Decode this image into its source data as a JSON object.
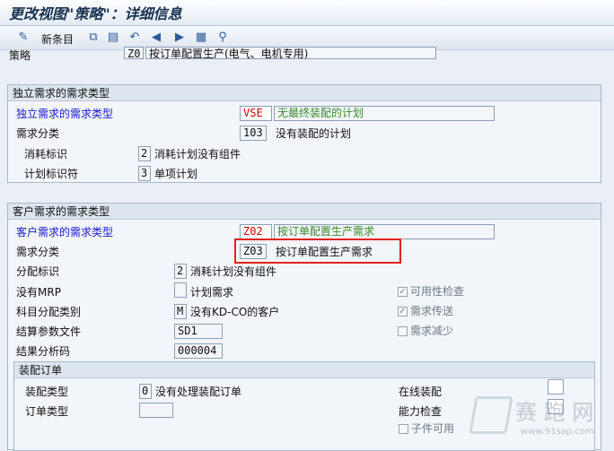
{
  "window": {
    "title": "更改视图\"策略\"：详细信息"
  },
  "toolbar": {
    "new_entries_label": "新条目"
  },
  "strategy": {
    "label": "策略",
    "code": "Z0",
    "description": "按订单配置生产(电气、电机专用)"
  },
  "independent": {
    "group_title": "独立需求的需求类型",
    "req_type_label": "独立需求的需求类型",
    "req_type_code": "VSE",
    "req_type_desc": "无最终装配的计划",
    "req_class_label": "需求分类",
    "req_class_code": "103",
    "req_class_desc": "没有装配的计划",
    "consumption_label": "消耗标识",
    "consumption_code": "2",
    "consumption_desc": "消耗计划没有组件",
    "planning_ind_label": "计划标识符",
    "planning_ind_code": "3",
    "planning_ind_desc": "单项计划"
  },
  "customer": {
    "group_title": "客户需求的需求类型",
    "req_type_label": "客户需求的需求类型",
    "req_type_code": "Z02",
    "req_type_desc": "按订单配置生产需求",
    "req_class_label": "需求分类",
    "req_class_code": "Z03",
    "req_class_desc": "按订单配置生产需求",
    "allocation_label": "分配标识",
    "allocation_code": "2",
    "allocation_desc": "消耗计划没有组件",
    "no_mrp_label": "没有MRP",
    "no_mrp_code": "",
    "no_mrp_desc": "计划需求",
    "acct_assign_label": "科目分配类别",
    "acct_assign_code": "M",
    "acct_assign_desc": "没有KD-CO的客户",
    "settlement_label": "结算参数文件",
    "settlement_value": "SD1",
    "results_label": "结果分析码",
    "results_value": "000004",
    "availability_check_label": "可用性检查",
    "req_transfer_label": "需求传送",
    "req_reduction_label": "需求减少",
    "check_mark": "✓"
  },
  "assembly": {
    "group_title": "装配订单",
    "assembly_type_label": "装配类型",
    "assembly_type_code": "0",
    "assembly_type_desc": "没有处理装配订单",
    "order_type_label": "订单类型",
    "online_assembly_label": "在线装配",
    "capacity_check_label": "能力检查",
    "components_avail_label": "子件可用"
  },
  "watermark": {
    "text": "赛 跑 网",
    "url": "www.91sap.com"
  }
}
